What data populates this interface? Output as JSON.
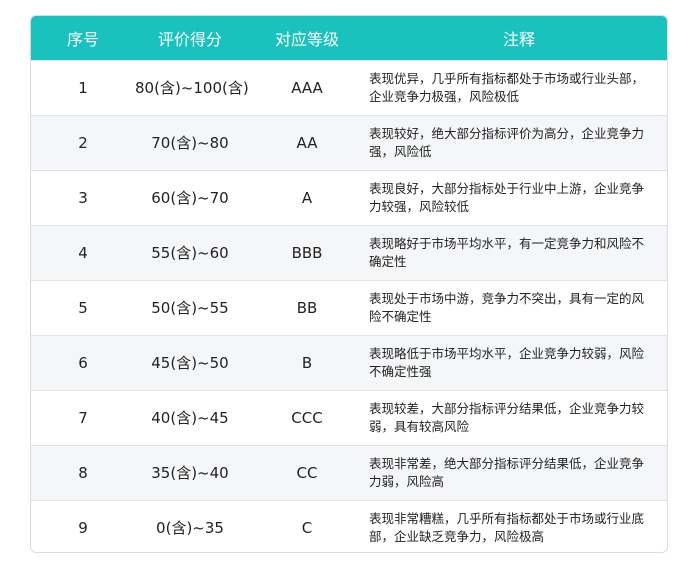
{
  "table": {
    "headers": [
      "序号",
      "评价得分",
      "对应等级",
      "注释"
    ],
    "rows": [
      {
        "no": "1",
        "score": "80(含)~100(含)",
        "grade": "AAA",
        "note": "表现优异，几乎所有指标都处于市场或行业头部，企业竞争力极强，风险极低"
      },
      {
        "no": "2",
        "score": "70(含)~80",
        "grade": "AA",
        "note": "表现较好，绝大部分指标评价为高分，企业竞争力强，风险低"
      },
      {
        "no": "3",
        "score": "60(含)~70",
        "grade": "A",
        "note": "表现良好，大部分指标处于行业中上游，企业竞争力较强，风险较低"
      },
      {
        "no": "4",
        "score": "55(含)~60",
        "grade": "BBB",
        "note": "表现略好于市场平均水平，有一定竞争力和风险不确定性"
      },
      {
        "no": "5",
        "score": "50(含)~55",
        "grade": "BB",
        "note": "表现处于市场中游，竞争力不突出，具有一定的风险不确定性"
      },
      {
        "no": "6",
        "score": "45(含)~50",
        "grade": "B",
        "note": "表现略低于市场平均水平，企业竞争力较弱，风险不确定性强"
      },
      {
        "no": "7",
        "score": "40(含)~45",
        "grade": "CCC",
        "note": "表现较差，大部分指标评分结果低，企业竞争力较弱，具有较高风险"
      },
      {
        "no": "8",
        "score": "35(含)~40",
        "grade": "CC",
        "note": "表现非常差，绝大部分指标评分结果低，企业竞争力弱，风险高"
      },
      {
        "no": "9",
        "score": "0(含)~35",
        "grade": "C",
        "note": "表现非常糟糕，几乎所有指标都处于市场或行业底部，企业缺乏竞争力，风险极高"
      }
    ]
  },
  "colors": {
    "header_bg": "#19c2bd",
    "header_text": "#ffffff",
    "stripe": "#f5f6f8"
  }
}
